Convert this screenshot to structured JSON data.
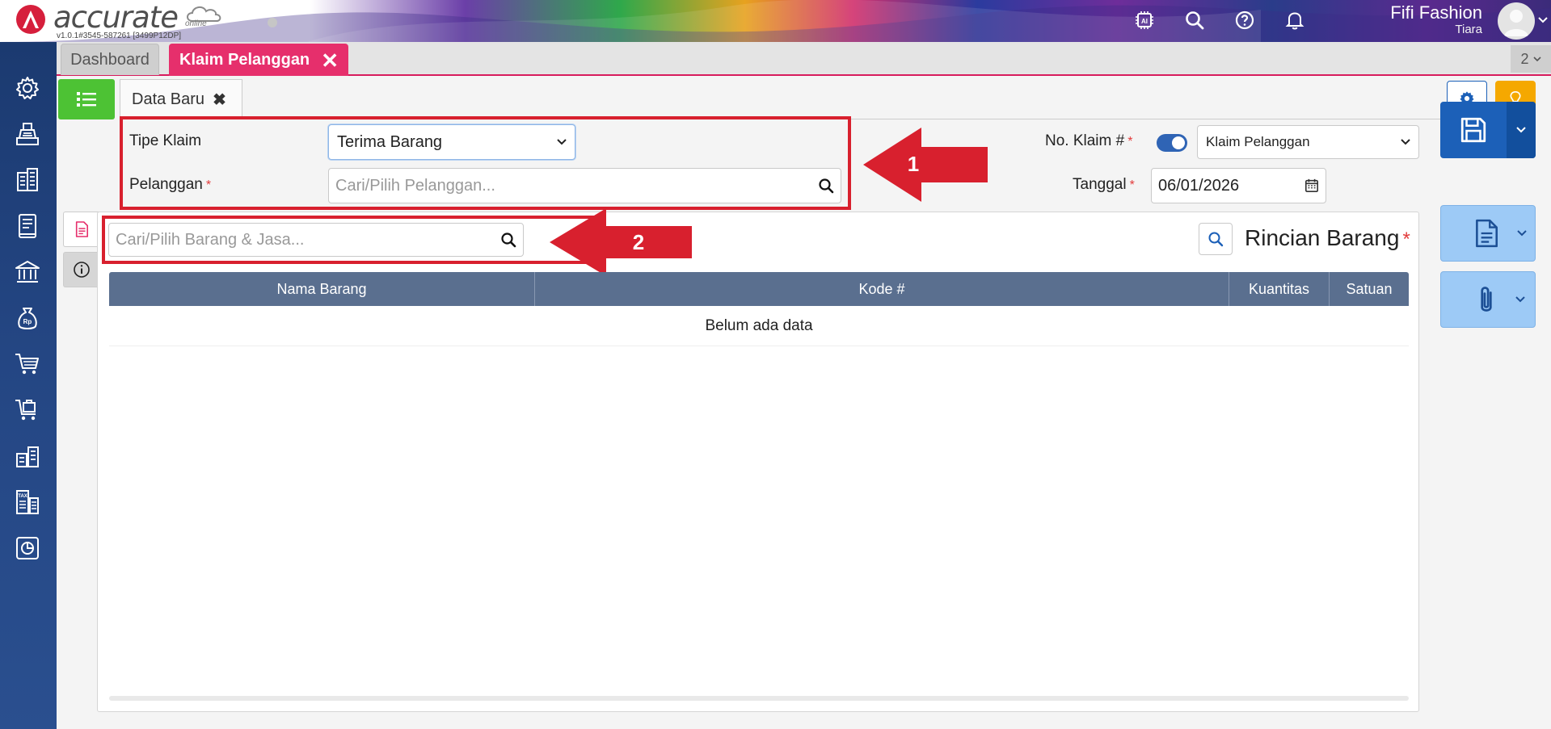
{
  "app": {
    "logo_text": "accurate",
    "logo_sub": "online",
    "version": "v1.0.1#3545-587261 [3499P12DP]"
  },
  "header": {
    "icons": [
      "ai-chip-icon",
      "search-icon",
      "help-icon",
      "bell-icon"
    ],
    "user_name": "Fifi Fashion",
    "user_sub": "Tiara"
  },
  "tabs": {
    "dashboard_label": "Dashboard",
    "active_label": "Klaim Pelanggan",
    "count": "2"
  },
  "sidebar": {
    "icons": [
      "settings-icon",
      "cashier-icon",
      "company-icon",
      "ledger-icon",
      "bank-icon",
      "money-bag-icon",
      "cart-icon",
      "purchase-cart-icon",
      "warehouse-icon",
      "tax-icon",
      "report-icon"
    ]
  },
  "form": {
    "subtab_label": "Data Baru",
    "tipe_klaim_label": "Tipe Klaim",
    "tipe_klaim_value": "Terima Barang",
    "pelanggan_label": "Pelanggan",
    "pelanggan_placeholder": "Cari/Pilih Pelanggan...",
    "no_klaim_label": "No. Klaim #",
    "no_klaim_value": "Klaim Pelanggan",
    "tanggal_label": "Tanggal",
    "tanggal_value": "06/01/2026",
    "required_mark": "*"
  },
  "annotations": {
    "callout_1": "1",
    "callout_2": "2"
  },
  "items": {
    "search_placeholder": "Cari/Pilih Barang & Jasa...",
    "title": "Rincian Barang",
    "columns": [
      "Nama Barang",
      "Kode #",
      "Kuantitas",
      "Satuan"
    ],
    "empty_text": "Belum ada data"
  },
  "colors": {
    "active_tab": "#e62f6c",
    "sidebar": "#244683",
    "annotation": "#d8202e",
    "save_button": "#1c60b8",
    "menu_button": "#4dc234",
    "tip_button": "#f5a800"
  }
}
